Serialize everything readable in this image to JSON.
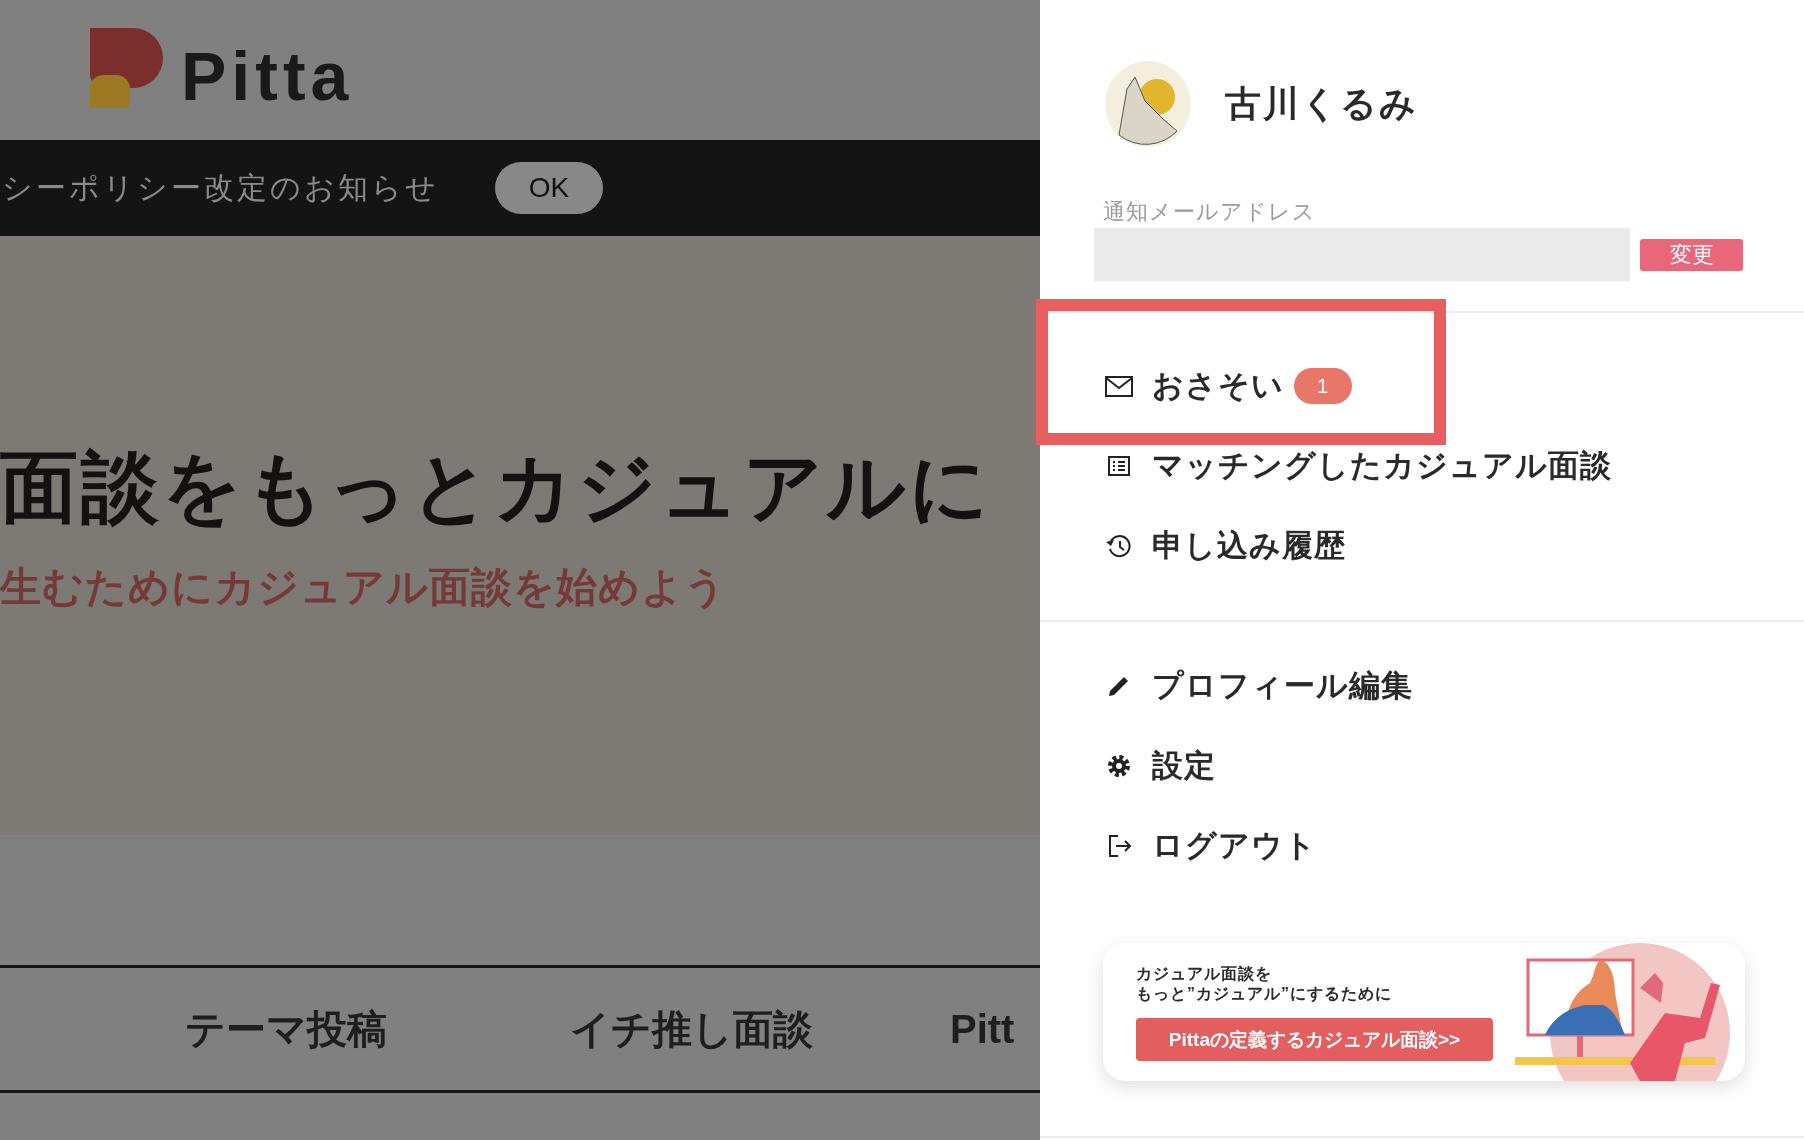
{
  "header": {
    "logo_text": "Pitta"
  },
  "notice_bar": {
    "text": "シーポリシー改定のお知らせ",
    "button": "OK"
  },
  "hero": {
    "heading": "面談をもっとカジュアルに",
    "subheading": "生むためにカジュアル面談を始めよう"
  },
  "nav": [
    {
      "label": "テーマ投稿"
    },
    {
      "label": "イチ推し面談"
    },
    {
      "label": "Pitt"
    }
  ],
  "drawer": {
    "user_name": "古川くるみ",
    "email": {
      "label": "通知メールアドレス",
      "button": "変更"
    },
    "menu_groups": [
      [
        {
          "label": "おさそい",
          "badge": "1",
          "highlighted": true
        },
        {
          "label": "マッチングしたカジュアル面談",
          "highlighted": false
        },
        {
          "label": "申し込み履歴",
          "highlighted": false
        }
      ],
      [
        {
          "label": "プロフィール編集",
          "highlighted": false
        },
        {
          "label": "設定",
          "highlighted": false
        },
        {
          "label": "ログアウト",
          "highlighted": false
        }
      ]
    ],
    "banner": {
      "lines": [
        "カジュアル面談を",
        "もっと”カジュアル”にするために"
      ],
      "button": "Pittaの定義するカジュアル面談>>"
    }
  }
}
